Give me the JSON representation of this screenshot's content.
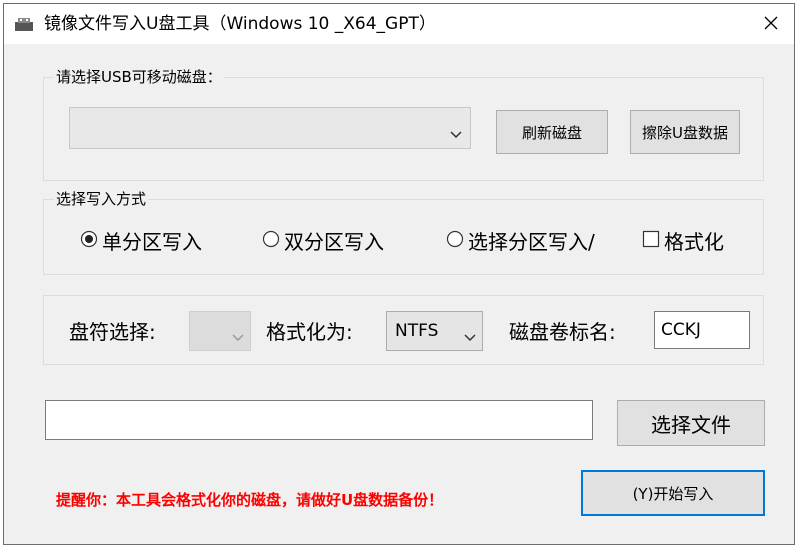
{
  "window": {
    "title": "镜像文件写入U盘工具（Windows 10 _X64_GPT）",
    "icons": {
      "app": "usb-drive-icon",
      "close": "close-icon"
    }
  },
  "disk_group": {
    "label": "请选择USB可移动磁盘：",
    "disk_select": {
      "value": ""
    },
    "refresh_button": "刷新磁盘",
    "erase_button": "擦除U盘数据"
  },
  "write_mode_group": {
    "label": "选择写入方式",
    "options": [
      {
        "label": "单分区写入",
        "checked": true
      },
      {
        "label": "双分区写入",
        "checked": false
      },
      {
        "label": "选择分区写入/",
        "checked": false
      }
    ],
    "format_checkbox": {
      "label": "格式化",
      "checked": false
    }
  },
  "partition_settings": {
    "drive_letter_label": "盘符选择:",
    "drive_letter_value": "",
    "format_as_label": "格式化为:",
    "format_as_value": "NTFS",
    "volume_label_label": "磁盘卷标名:",
    "volume_label_value": "CCKJ"
  },
  "file_select": {
    "path_value": "",
    "select_file_button": "选择文件"
  },
  "footer": {
    "warning": "提醒你：本工具会格式化你的磁盘，请做好U盘数据备份！",
    "start_button": "(Y)开始写入"
  },
  "colors": {
    "window_bg": "#f0f0f0",
    "titlebar_bg": "#ffffff",
    "warning_text": "#ff0000",
    "default_button_border": "#0078d7"
  }
}
